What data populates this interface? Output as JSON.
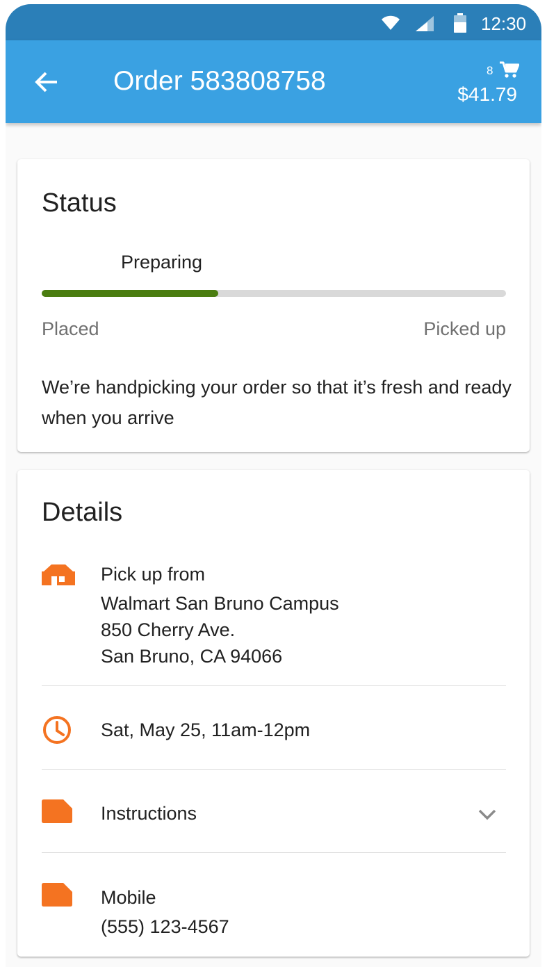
{
  "status_bar": {
    "time": "12:30",
    "icons": [
      "wifi-icon",
      "signal-icon",
      "battery-icon"
    ]
  },
  "app_bar": {
    "back_icon": "arrow-left-icon",
    "title": "Order 583808758",
    "cart_count": "8",
    "cart_icon": "cart-icon",
    "cart_total": "$41.79"
  },
  "status_card": {
    "title": "Status",
    "progress_label": "Preparing",
    "progress": 0.38,
    "progress_start_label": "Placed",
    "progress_end_label": "Picked up",
    "message": "We’re handpicking your order so that it’s fresh and ready when you arrive"
  },
  "details_card": {
    "title": "Details",
    "pickup": {
      "icon": "store-icon",
      "label": "Pick up from",
      "store_name": "Walmart San Bruno Campus",
      "address_line1": "850 Cherry Ave.",
      "address_line2": "San Bruno, CA 94066"
    },
    "time_slot": {
      "icon": "clock-icon",
      "text": "Sat, May 25, 11am-12pm"
    },
    "instructions": {
      "icon": "note-icon",
      "label": "Instructions",
      "expand_icon": "chevron-down-icon"
    },
    "mobile": {
      "icon": "note-icon",
      "label": "Mobile",
      "number": "(555) 123-4567"
    }
  },
  "colors": {
    "status_bar": "#2b7fb8",
    "app_bar": "#3aa1e2",
    "progress_fill": "#4a7d10",
    "progress_track": "#d9d9d9",
    "icon_accent": "#f47321",
    "text_primary": "#212121",
    "text_secondary": "#707070"
  }
}
